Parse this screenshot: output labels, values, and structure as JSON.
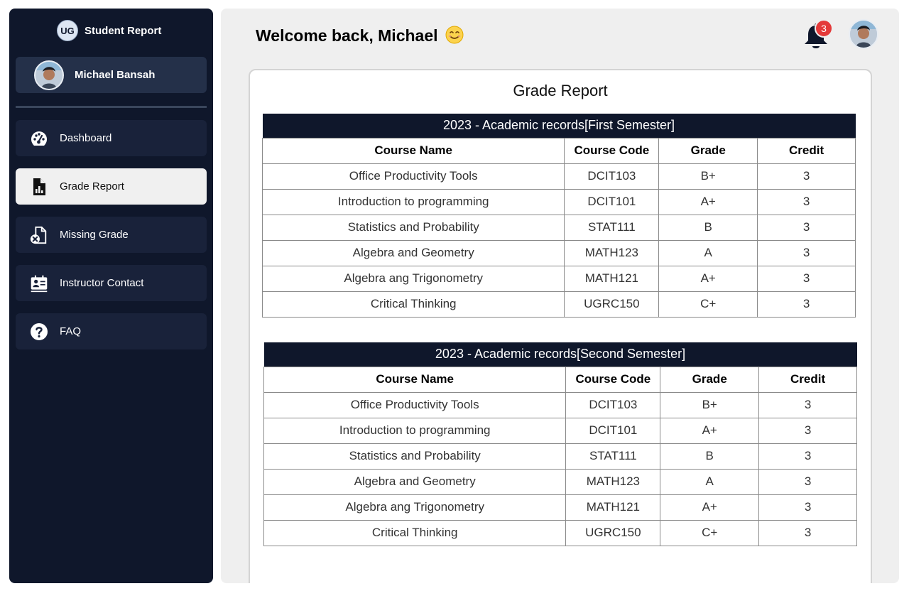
{
  "sidebar": {
    "brand_badge": "UG",
    "brand_title": "Student Report",
    "user_name": "Michael Bansah",
    "items": [
      {
        "label": "Dashboard",
        "icon": "dashboard-gauge-icon",
        "active": false
      },
      {
        "label": "Grade Report",
        "icon": "file-chart-icon",
        "active": true
      },
      {
        "label": "Missing Grade",
        "icon": "file-x-icon",
        "active": false
      },
      {
        "label": "Instructor Contact",
        "icon": "contact-card-icon",
        "active": false
      },
      {
        "label": "FAQ",
        "icon": "question-circle-icon",
        "active": false
      }
    ]
  },
  "header": {
    "welcome": "Welcome back, Michael",
    "notification_count": "3"
  },
  "report": {
    "title": "Grade Report",
    "columns": [
      "Course Name",
      "Course Code",
      "Grade",
      "Credit"
    ],
    "semesters": [
      {
        "caption": "2023 - Academic records[First Semester]",
        "rows": [
          [
            "Office Productivity Tools",
            "DCIT103",
            "B+",
            "3"
          ],
          [
            "Introduction to programming",
            "DCIT101",
            "A+",
            "3"
          ],
          [
            "Statistics and Probability",
            "STAT111",
            "B",
            "3"
          ],
          [
            "Algebra and Geometry",
            "MATH123",
            "A",
            "3"
          ],
          [
            "Algebra ang Trigonometry",
            "MATH121",
            "A+",
            "3"
          ],
          [
            "Critical Thinking",
            "UGRC150",
            "C+",
            "3"
          ]
        ]
      },
      {
        "caption": "2023 - Academic records[Second Semester]",
        "rows": [
          [
            "Office Productivity Tools",
            "DCIT103",
            "B+",
            "3"
          ],
          [
            "Introduction to programming",
            "DCIT101",
            "A+",
            "3"
          ],
          [
            "Statistics and Probability",
            "STAT111",
            "B",
            "3"
          ],
          [
            "Algebra and Geometry",
            "MATH123",
            "A",
            "3"
          ],
          [
            "Algebra ang Trigonometry",
            "MATH121",
            "A+",
            "3"
          ],
          [
            "Critical Thinking",
            "UGRC150",
            "C+",
            "3"
          ]
        ]
      }
    ]
  },
  "colors": {
    "sidebar_bg": "#0f172b",
    "active_item_bg": "#f0f0f0",
    "badge": "#e43a3a"
  }
}
